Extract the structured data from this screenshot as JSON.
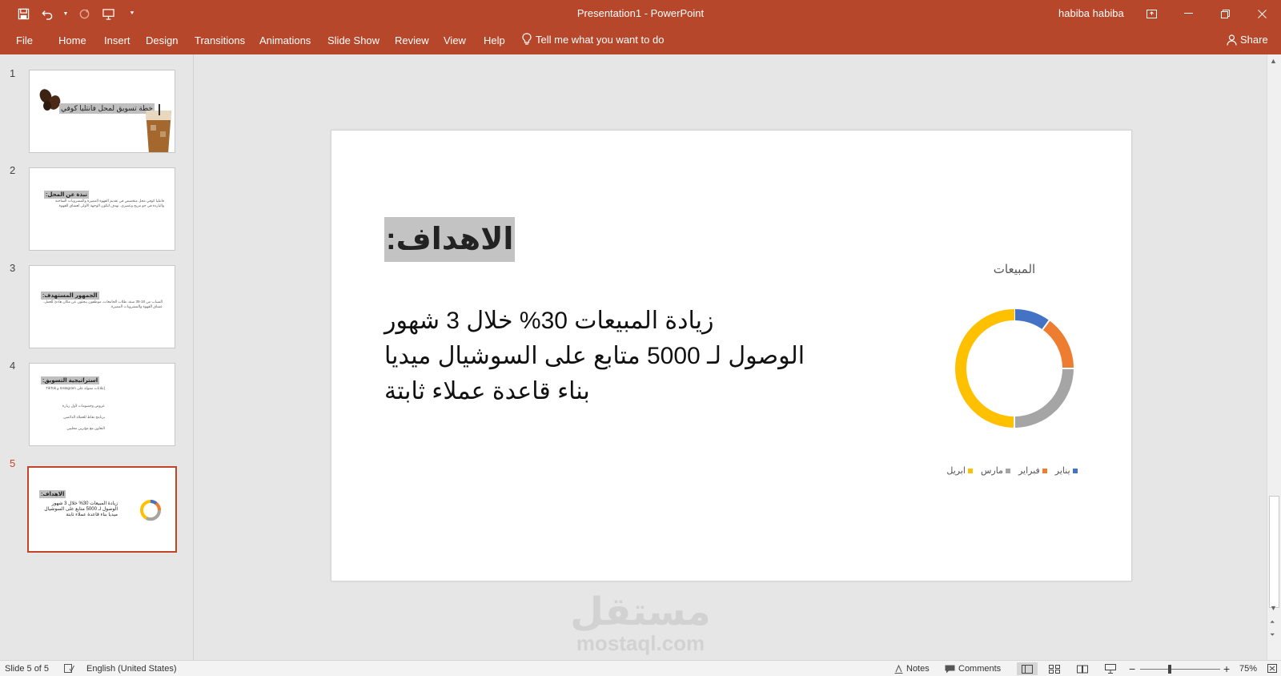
{
  "app": {
    "window_title": "Presentation1  -  PowerPoint",
    "user_name": "habiba habiba",
    "share_label": "Share"
  },
  "ribbon": {
    "tabs": [
      "File",
      "Home",
      "Insert",
      "Design",
      "Transitions",
      "Animations",
      "Slide Show",
      "Review",
      "View",
      "Help"
    ],
    "tell_me": "Tell me what you want to do"
  },
  "thumbnails": [
    {
      "number": "1",
      "title": "خطة تسويق لمحل فانتليا كوفي"
    },
    {
      "number": "2",
      "title": "نبذة عن المحل:",
      "text": "فانتليا كوفي محل متخصص في تقديم القهوة المميزة والمشروبات الساخنة والباردة في جو مريح وعصري. نهدف لتكون الوجهة الأولى لعشاق القهوة."
    },
    {
      "number": "3",
      "title": "الجمهور المستهدف:",
      "text": "الشباب من 18-35 سنة، طلاب الجامعات، موظفون يبحثون عن مكان هادئ للعمل، عشاق القهوة والمشروبات المميزة."
    },
    {
      "number": "4",
      "title": "استراتيجية التسويق:",
      "bullets": [
        "إعلانات ممولة على Instagram و TikTok",
        "عروض وخصومات لأول زيارة",
        "برنامج نقاط للعملاء الدائمين",
        "التعاون مع مؤثرين محليين"
      ]
    },
    {
      "number": "5",
      "title": "الاهداف:",
      "text": "زيادة المبيعات 30% خلال 3 شهور الوصول لـ 5000 متابع على السوشيال ميديا بناء قاعدة عملاء ثابتة"
    }
  ],
  "slide": {
    "title": "الاهداف:",
    "bullets": [
      "زيادة المبيعات 30% خلال 3 شهور",
      "الوصول لـ 5000 متابع على السوشيال ميديا",
      "بناء قاعدة عملاء ثابتة"
    ]
  },
  "chart_data": {
    "type": "pie",
    "donut": true,
    "title": "المبيعات",
    "categories": [
      "يناير",
      "فبراير",
      "مارس",
      "ابريل"
    ],
    "values": [
      10,
      15,
      25,
      50
    ],
    "colors": [
      "#4472c4",
      "#ed7d31",
      "#a5a5a5",
      "#ffc000"
    ],
    "legend_position": "bottom"
  },
  "watermark": {
    "arabic": "مستقل",
    "latin": "mostaql.com"
  },
  "statusbar": {
    "slide_info": "Slide 5 of 5",
    "language": "English (United States)",
    "notes": "Notes",
    "comments": "Comments",
    "zoom": "75%"
  },
  "icons": {
    "save": "save-icon",
    "undo": "undo-icon",
    "redo": "redo-icon",
    "present": "present-from-start-icon"
  }
}
